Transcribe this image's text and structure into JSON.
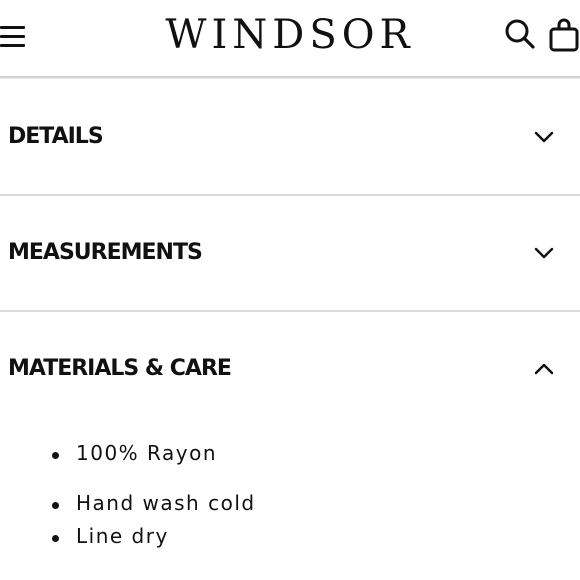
{
  "header": {
    "brand": "WINDSOR",
    "menu_icon": "hamburger-menu-icon",
    "search_icon": "search-icon",
    "bag_icon": "shopping-bag-icon"
  },
  "accordion": [
    {
      "label": "DETAILS",
      "state": "collapsed",
      "icon": "chevron-down-icon"
    },
    {
      "label": "MEASUREMENTS",
      "state": "collapsed",
      "icon": "chevron-down-icon"
    },
    {
      "label": "MATERIALS & CARE",
      "state": "expanded",
      "icon": "chevron-up-icon"
    }
  ],
  "materials_care": {
    "items": [
      "100% Rayon",
      "Hand wash cold",
      "Line dry"
    ]
  }
}
